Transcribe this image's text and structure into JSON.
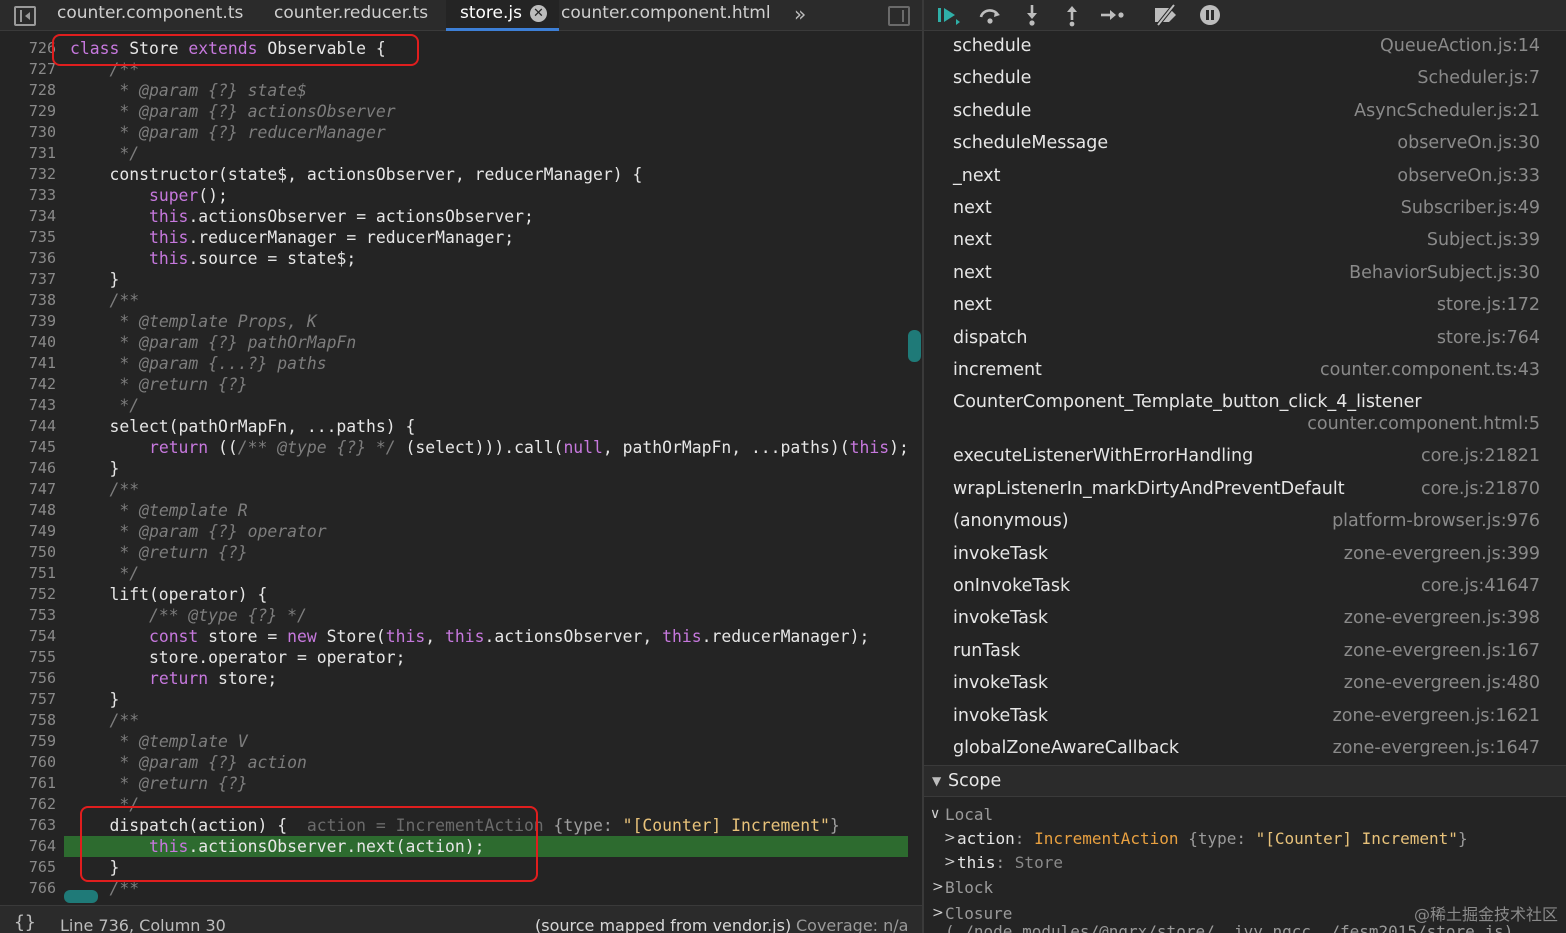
{
  "tabs": [
    {
      "label": "counter.component.ts",
      "active": false
    },
    {
      "label": "counter.reducer.ts",
      "active": false
    },
    {
      "label": "store.js",
      "active": true
    },
    {
      "label": "counter.component.html",
      "active": false
    }
  ],
  "tab_overflow": "»",
  "code_lines": [
    {
      "num": "726",
      "html": "<span class=\"kw\">class</span> Store <span class=\"kw\">extends</span> Observable {"
    },
    {
      "num": "727",
      "html": "    <span class=\"cm\">/**</span>"
    },
    {
      "num": "728",
      "html": "    <span class=\"cm\"> * @param {?} state$</span>"
    },
    {
      "num": "729",
      "html": "    <span class=\"cm\"> * @param {?} actionsObserver</span>"
    },
    {
      "num": "730",
      "html": "    <span class=\"cm\"> * @param {?} reducerManager</span>"
    },
    {
      "num": "731",
      "html": "    <span class=\"cm\"> */</span>"
    },
    {
      "num": "732",
      "html": "    constructor(state$, actionsObserver, reducerManager) {"
    },
    {
      "num": "733",
      "html": "        <span class=\"kw\">super</span>();"
    },
    {
      "num": "734",
      "html": "        <span class=\"kw\">this</span>.actionsObserver = actionsObserver;"
    },
    {
      "num": "735",
      "html": "        <span class=\"kw\">this</span>.reducerManager = reducerManager;"
    },
    {
      "num": "736",
      "html": "        <span class=\"kw\">this</span>.source = state$;"
    },
    {
      "num": "737",
      "html": "    }"
    },
    {
      "num": "738",
      "html": "    <span class=\"cm\">/**</span>"
    },
    {
      "num": "739",
      "html": "    <span class=\"cm\"> * @template Props, K</span>"
    },
    {
      "num": "740",
      "html": "    <span class=\"cm\"> * @param {?} pathOrMapFn</span>"
    },
    {
      "num": "741",
      "html": "    <span class=\"cm\"> * @param {...?} paths</span>"
    },
    {
      "num": "742",
      "html": "    <span class=\"cm\"> * @return {?}</span>"
    },
    {
      "num": "743",
      "html": "    <span class=\"cm\"> */</span>"
    },
    {
      "num": "744",
      "html": "    select(pathOrMapFn, ...paths) {"
    },
    {
      "num": "745",
      "html": "        <span class=\"kw\">return</span> ((<span class=\"cm\">/** @type {?} */</span> (select))).call(<span class=\"kw\">null</span>, pathOrMapFn, ...paths)(<span class=\"kw\">this</span>);"
    },
    {
      "num": "746",
      "html": "    }"
    },
    {
      "num": "747",
      "html": "    <span class=\"cm\">/**</span>"
    },
    {
      "num": "748",
      "html": "    <span class=\"cm\"> * @template R</span>"
    },
    {
      "num": "749",
      "html": "    <span class=\"cm\"> * @param {?} operator</span>"
    },
    {
      "num": "750",
      "html": "    <span class=\"cm\"> * @return {?}</span>"
    },
    {
      "num": "751",
      "html": "    <span class=\"cm\"> */</span>"
    },
    {
      "num": "752",
      "html": "    lift(operator) {"
    },
    {
      "num": "753",
      "html": "        <span class=\"cm\">/** @type {?} */</span>"
    },
    {
      "num": "754",
      "html": "        <span class=\"kw\">const</span> store = <span class=\"kw\">new</span> Store(<span class=\"kw\">this</span>, <span class=\"kw\">this</span>.actionsObserver, <span class=\"kw\">this</span>.reducerManager);"
    },
    {
      "num": "755",
      "html": "        store.operator = operator;"
    },
    {
      "num": "756",
      "html": "        <span class=\"kw\">return</span> store;"
    },
    {
      "num": "757",
      "html": "    }"
    },
    {
      "num": "758",
      "html": "    <span class=\"cm\">/**</span>"
    },
    {
      "num": "759",
      "html": "    <span class=\"cm\"> * @template V</span>"
    },
    {
      "num": "760",
      "html": "    <span class=\"cm\"> * @param {?} action</span>"
    },
    {
      "num": "761",
      "html": "    <span class=\"cm\"> * @return {?}</span>"
    },
    {
      "num": "762",
      "html": "    <span class=\"cm\"> */</span>"
    },
    {
      "num": "763",
      "html": "    dispatch(action) {  <span class=\"inline-val\">action = IncrementAction <span class=\"obj\">{type: <span class=\"str\">\"[Counter] Increment\"</span>}</span></span>"
    },
    {
      "num": "764",
      "html": "        <span class=\"kw\">this</span>.actionsObserver.next(action);",
      "exec": true
    },
    {
      "num": "765",
      "html": "    }"
    },
    {
      "num": "766",
      "html": "    <span class=\"cm\">/**</span>"
    }
  ],
  "status": {
    "braces": "{}",
    "position": "Line 736, Column 30",
    "source_mapped": "(source mapped from vendor.js)",
    "coverage": "Coverage: n/a"
  },
  "call_stack": [
    {
      "name": "schedule",
      "loc": "QueueAction.js:14"
    },
    {
      "name": "schedule",
      "loc": "Scheduler.js:7"
    },
    {
      "name": "schedule",
      "loc": "AsyncScheduler.js:21"
    },
    {
      "name": "scheduleMessage",
      "loc": "observeOn.js:30"
    },
    {
      "name": "_next",
      "loc": "observeOn.js:33"
    },
    {
      "name": "next",
      "loc": "Subscriber.js:49"
    },
    {
      "name": "next",
      "loc": "Subject.js:39"
    },
    {
      "name": "next",
      "loc": "BehaviorSubject.js:30"
    },
    {
      "name": "next",
      "loc": "store.js:172"
    },
    {
      "name": "dispatch",
      "loc": "store.js:764"
    },
    {
      "name": "increment",
      "loc": "counter.component.ts:43"
    },
    {
      "name": "CounterComponent_Template_button_click_4_listener",
      "loc": "counter.component.html:5",
      "tall": true
    },
    {
      "name": "executeListenerWithErrorHandling",
      "loc": "core.js:21821"
    },
    {
      "name": "wrapListenerIn_markDirtyAndPreventDefault",
      "loc": "core.js:21870"
    },
    {
      "name": "(anonymous)",
      "loc": "platform-browser.js:976"
    },
    {
      "name": "invokeTask",
      "loc": "zone-evergreen.js:399"
    },
    {
      "name": "onInvokeTask",
      "loc": "core.js:41647"
    },
    {
      "name": "invokeTask",
      "loc": "zone-evergreen.js:398"
    },
    {
      "name": "runTask",
      "loc": "zone-evergreen.js:167"
    },
    {
      "name": "invokeTask",
      "loc": "zone-evergreen.js:480"
    },
    {
      "name": "invokeTask",
      "loc": "zone-evergreen.js:1621"
    },
    {
      "name": "globalZoneAwareCallback",
      "loc": "zone-evergreen.js:1647"
    }
  ],
  "scope": {
    "title": "Scope",
    "local_label": "Local",
    "action_name": "action",
    "action_class": "IncrementAction",
    "action_open": "{type: ",
    "action_value": "\"[Counter] Increment\"",
    "action_close": "}",
    "this_name": "this",
    "this_type": "Store",
    "block_label": "Block",
    "closure_label": "Closure",
    "closure_path": "(./node_modules/@ngrx/store/__ivy_ngcc__/fesm2015/store.js)"
  },
  "watermark": "@稀土掘金技术社区"
}
